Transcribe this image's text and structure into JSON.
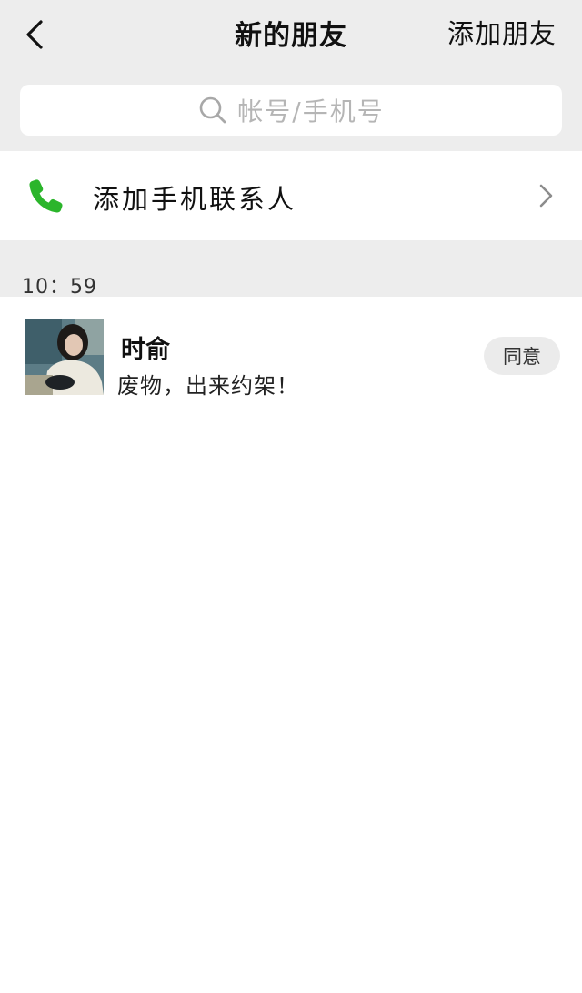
{
  "header": {
    "title": "新的朋友",
    "action_label": "添加朋友",
    "back_icon": "chevron-left-icon"
  },
  "search": {
    "placeholder": "帐号/手机号",
    "icon": "search-icon"
  },
  "phone_contacts": {
    "label": "添加手机联系人",
    "icon": "phone-icon",
    "icon_color": "#2bb52b",
    "arrow_icon": "chevron-right-icon"
  },
  "section": {
    "time": "10：59"
  },
  "requests": [
    {
      "name": "时俞",
      "message": "废物，出来约架！",
      "action_label": "同意"
    }
  ],
  "colors": {
    "header_bg": "#ededed",
    "accent_green": "#2bb52b",
    "button_bg": "#ebebeb"
  }
}
